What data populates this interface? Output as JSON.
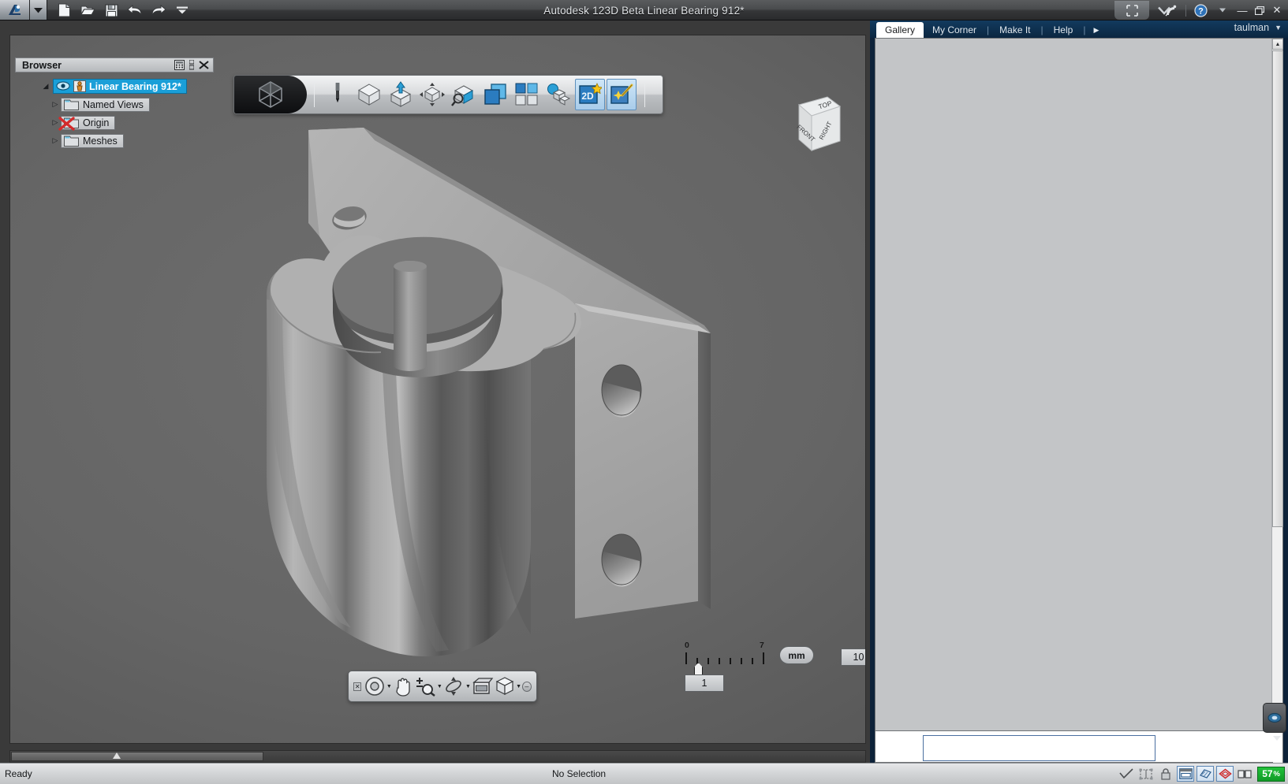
{
  "window": {
    "title": "Autodesk 123D Beta   Linear Bearing 912*",
    "app_name": "Autodesk 123D Beta",
    "document_name": "Linear Bearing 912*",
    "minimize": "—",
    "restore": "❐",
    "close": "✕",
    "help_icon": "help-icon",
    "satellite_icon": "satellite-dish-icon",
    "dropdown_caret": "▼"
  },
  "quick_access": {
    "items": [
      {
        "name": "new-document",
        "icon": "new-file-icon"
      },
      {
        "name": "open-document",
        "icon": "open-folder-icon"
      },
      {
        "name": "save-document",
        "icon": "save-disk-icon"
      },
      {
        "name": "undo",
        "icon": "undo-arrow-icon"
      },
      {
        "name": "redo",
        "icon": "redo-arrow-icon"
      },
      {
        "name": "customize",
        "icon": "chevron-down-icon"
      }
    ]
  },
  "browser": {
    "title": "Browser",
    "header_icons": [
      "calculator-icon",
      "list-icon",
      "close-icon"
    ],
    "tree": [
      {
        "label": "Linear Bearing 912*",
        "selected": true,
        "expander": "◢",
        "icon": "assembly-icon",
        "visibility_icon": "eye-icon"
      },
      {
        "label": "Named Views",
        "selected": false,
        "expander": "▷",
        "icon": "folder-icon"
      },
      {
        "label": "Origin",
        "selected": false,
        "expander": "▷",
        "icon": "folder-icon",
        "overlay": "hidden-x-icon"
      },
      {
        "label": "Meshes",
        "selected": false,
        "expander": "▷",
        "icon": "folder-icon"
      }
    ]
  },
  "command_toolbar": {
    "logo": "123d-cube-logo",
    "items": [
      {
        "name": "sketch-tool",
        "icon": "pencil-icon",
        "active": false
      },
      {
        "name": "primitives-tool",
        "icon": "cube-icon",
        "active": false
      },
      {
        "name": "extrude-tool",
        "icon": "cube-up-arrow-icon",
        "active": false
      },
      {
        "name": "modify-tool",
        "icon": "cube-arrows-icon",
        "active": false
      },
      {
        "name": "measure-tool",
        "icon": "cube-magnifier-icon",
        "active": false
      },
      {
        "name": "combine-tool",
        "icon": "overlapping-squares-icon",
        "active": false
      },
      {
        "name": "pattern-tool",
        "icon": "grid-squares-icon",
        "active": false
      },
      {
        "name": "assembly-tool",
        "icon": "blocks-sphere-icon",
        "active": false
      },
      {
        "name": "2d-sketch-tool",
        "icon": "2d-star-icon",
        "active": true
      },
      {
        "name": "effects-tool",
        "icon": "magic-wand-icon",
        "active": true
      }
    ]
  },
  "viewcube": {
    "top_label": "TOP",
    "front_label": "FRONT",
    "right_label": "RIGHT"
  },
  "scale": {
    "start_label": "0",
    "end_label": "7",
    "unit": "mm",
    "scale_value": "10",
    "grid_value": "1"
  },
  "navigation_bar": {
    "items": [
      {
        "name": "steering-wheel",
        "icon": "steering-wheel-icon",
        "has_caret": true
      },
      {
        "name": "pan-tool",
        "icon": "hand-pan-icon",
        "has_caret": false
      },
      {
        "name": "zoom-tool",
        "icon": "zoom-magnifier-icon",
        "has_caret": true
      },
      {
        "name": "orbit-tool",
        "icon": "orbit-icon",
        "has_caret": true
      },
      {
        "name": "show-motion",
        "icon": "display-window-icon",
        "has_caret": false
      },
      {
        "name": "visual-style",
        "icon": "style-cube-icon",
        "has_caret": true
      }
    ],
    "close_icon": "✕",
    "minimize_icon": "–"
  },
  "right_panel": {
    "tabs": [
      {
        "label": "Gallery",
        "active": true
      },
      {
        "label": "My Corner",
        "active": false
      },
      {
        "label": "Make It",
        "active": false
      },
      {
        "label": "Help",
        "active": false
      }
    ],
    "tab_separator": "|",
    "more_arrow": "▶",
    "user": "taulman",
    "user_caret": "▼"
  },
  "status_bar": {
    "left_text": "Ready",
    "center_text": "No Selection",
    "progress_value": "57",
    "progress_suffix": "%",
    "icons": [
      {
        "name": "check-snap-icon",
        "boxed": false
      },
      {
        "name": "grid-snap-icon",
        "boxed": false
      },
      {
        "name": "lock-icon",
        "boxed": false
      },
      {
        "name": "window-layout-icon",
        "boxed": true
      },
      {
        "name": "shading-icon",
        "boxed": true
      },
      {
        "name": "section-icon",
        "boxed": true
      },
      {
        "name": "book-icon",
        "boxed": false
      }
    ]
  },
  "model": {
    "description": "Linear bearing block with cylindrical bore and mounting flange",
    "body_color": "#9a9a9a",
    "shadow_color": "#4f4f4f",
    "background_color": "#636363"
  }
}
